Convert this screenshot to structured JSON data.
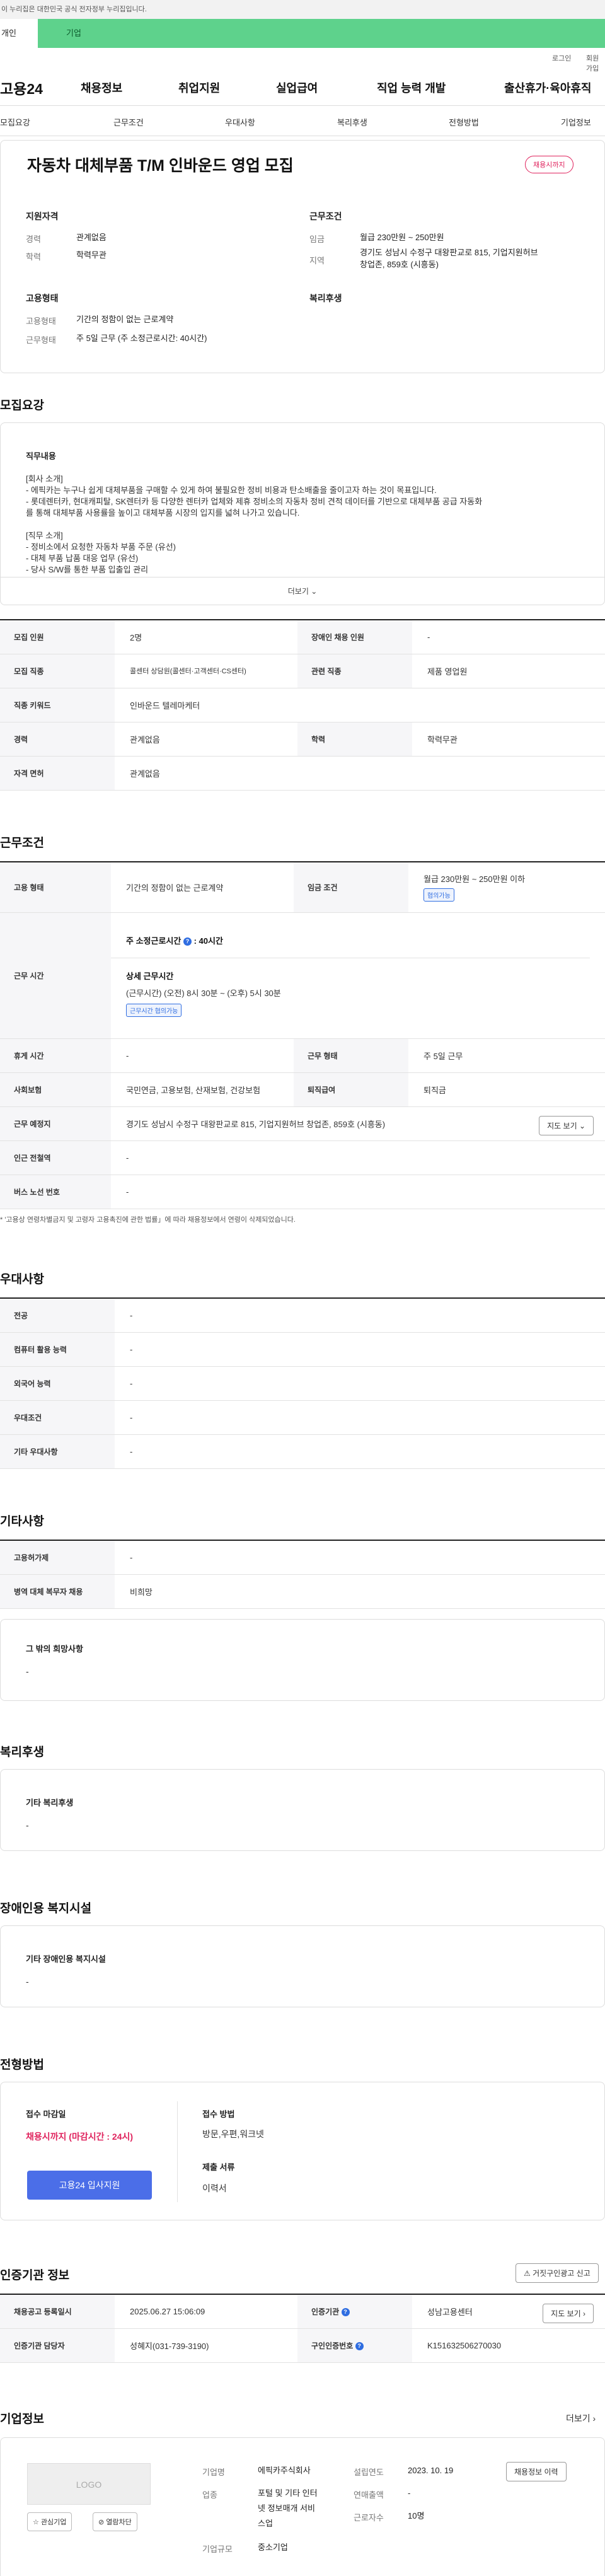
{
  "gov_banner": "이 누리집은 대한민국 공식 전자정부 누리집입니다.",
  "user_tabs": [
    "개인",
    "기업"
  ],
  "top_links": [
    "로그인",
    "회원가입"
  ],
  "logo": "고용24",
  "gnb": [
    "채용정보",
    "취업지원",
    "실업급여",
    "직업 능력 개발",
    "출산휴가·육아휴직"
  ],
  "anchors": [
    "모집요강",
    "근무조건",
    "우대사항",
    "복리후생",
    "전형방법",
    "기업정보"
  ],
  "job": {
    "title": "자동차 대체부품 T/M 인바운드 영업 모집",
    "badge": "채용시까지",
    "qual_title": "지원자격",
    "career_k": "경력",
    "career_v": "관계없음",
    "edu_k": "학력",
    "edu_v": "학력무관",
    "cond_title": "근무조건",
    "wage_k": "임금",
    "wage_v": "월급 230만원 ~ 250만원",
    "loc_k": "지역",
    "loc_v1": "경기도 성남시 수정구 대왕판교로 815, 기업지원허브",
    "loc_v2": "창업존, 859호 (시흥동)",
    "emp_title": "고용형태",
    "emptype_k": "고용형태",
    "emptype_v": "기간의 정함이 없는 근로계약",
    "worktype_k": "근무형태",
    "worktype_v": "주 5일 근무 (주 소정근로시간: 40시간)",
    "welfare_title": "복리후생"
  },
  "recruit": {
    "title": "모집요강",
    "duty_label": "직무내용",
    "duty_text": "[회사 소개]\n- 에픽카는 누구나 쉽게 대체부품을 구매할 수 있게 하여 불필요한 정비 비용과 탄소배출을 줄이고자 하는 것이 목표입니다.\n- 롯데렌터카, 현대캐피탈, SK렌터카 등 다양한 렌터카 업체와 제휴 정비소의 자동차 정비 견적 데이터를 기반으로 대체부품 공급 자동화\n를 통해 대체부품 사용률을 높이고 대체부품 시장의 입지를 넓혀 나가고 있습니다.\n\n[직무 소개]\n- 정비소에서 요청한 자동차 부품 주문 (유선)\n- 대체 부품 납품 대응 업무 (유선)\n- 당사 S/W를 통한 부품 입출입 관리",
    "more": "더보기",
    "rows": [
      [
        "모집 인원",
        "2명",
        "장애인 채용 인원",
        "-"
      ],
      [
        "모집 직종",
        "콜센터 상담원(콜센터·고객센터·CS센터)",
        "관련 직종",
        "제품 영업원"
      ],
      [
        "직종 키워드",
        "인바운드 텔레마케터"
      ],
      [
        "경력",
        "관계없음",
        "학력",
        "학력무관"
      ],
      [
        "자격 면허",
        "관계없음"
      ]
    ]
  },
  "work": {
    "title": "근무조건",
    "r1": [
      "고용 형태",
      "기간의 정함이 없는 근로계약",
      "임금 조건",
      "월급 230만원 ~ 250만원 이하",
      "협의가능"
    ],
    "hours_k": "근무 시간",
    "weekly": "주 소정근로시간",
    "weekly_v": ": 40시간",
    "detail_t": "상세 근무시간",
    "detail_v": "(근무시간) (오전) 8시 30분 ~ (오후) 5시 30분",
    "detail_tag": "근무시간 협의가능",
    "r3": [
      "휴게 시간",
      "-",
      "근무 형태",
      "주 5일 근무"
    ],
    "r4": [
      "사회보험",
      "국민연금, 고용보험, 산재보험, 건강보험",
      "퇴직급여",
      "퇴직금"
    ],
    "r5": [
      "근무 예정지",
      "경기도 성남시 수정구 대왕판교로 815, 기업지원허브 창업존, 859호 (시흥동)",
      "지도 보기"
    ],
    "r6": [
      "인근 전철역",
      "-"
    ],
    "r7": [
      "버스 노선 번호",
      "-"
    ],
    "note": "* '고용상 연령차별금지 및 고령자 고용촉진에 관한 법률」에 따라 채용정보에서 연령이 삭제되었습니다."
  },
  "pref": {
    "title": "우대사항",
    "rows": [
      [
        "전공",
        "-"
      ],
      [
        "컴퓨터 활용 능력",
        "-"
      ],
      [
        "외국어 능력",
        "-"
      ],
      [
        "우대조건",
        "-"
      ],
      [
        "기타 우대사항",
        "-"
      ]
    ]
  },
  "etc": {
    "title": "기타사항",
    "rows": [
      [
        "고용허가제",
        "-"
      ],
      [
        "병역 대체 복무자 채용",
        "비희망"
      ]
    ],
    "wish_label": "그 밖의 희망사항",
    "wish_v": "-"
  },
  "welfare": {
    "title": "복리후생",
    "label": "기타 복리후생",
    "v": "-"
  },
  "facility": {
    "title": "장애인용 복지시설",
    "label": "기타 장애인용 복지시설",
    "v": "-"
  },
  "process": {
    "title": "전형방법",
    "deadline_t": "접수 마감일",
    "deadline_v": "채용시까지 (마감시간 : 24시)",
    "apply": "고용24 입사지원",
    "method_t": "접수 방법",
    "method_v": "방문,우편,워크넷",
    "docs_t": "제출 서류",
    "docs_v": "이력서"
  },
  "certify": {
    "title": "인증기관 정보",
    "report": "거짓구인광고 신고",
    "r1": [
      "채용공고 등록일시",
      "2025.06.27 15:06:09",
      "인증기관",
      "성남고용센터",
      "지도 보기"
    ],
    "r2": [
      "인증기관 담당자",
      "성혜지(031-739-3190)",
      "구인인증번호",
      "K151632506270030"
    ]
  },
  "company": {
    "title": "기업정보",
    "more": "더보기",
    "logo": "LOGO",
    "fav": "관심기업",
    "block": "열람차단",
    "k1": "기업명",
    "v1": "에픽카주식회사",
    "k2": "업종",
    "v2a": "포털 및 기타 인터",
    "v2b": "넷 정보매개 서비",
    "v2c": "스업",
    "k3": "기업규모",
    "v3": "중소기업",
    "k4": "설립연도",
    "v4": "2023. 10. 19",
    "k5": "연매출액",
    "v5": "-",
    "k6": "근로자수",
    "v6": "10명",
    "btn": "채용정보 이력"
  }
}
